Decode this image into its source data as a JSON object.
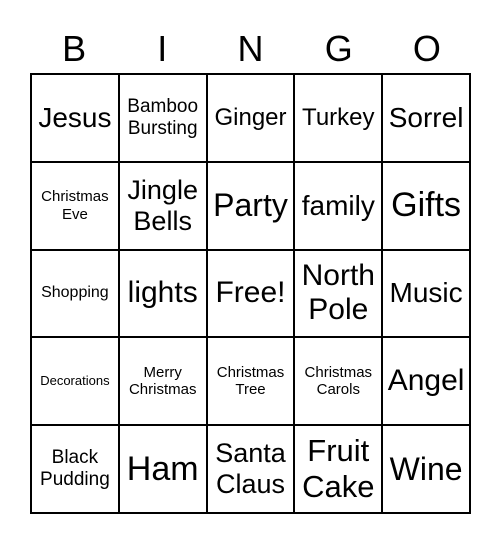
{
  "header": [
    "B",
    "I",
    "N",
    "G",
    "O"
  ],
  "cells": [
    {
      "text": "Jesus",
      "size": 28
    },
    {
      "text": "Bamboo Bursting",
      "size": 19
    },
    {
      "text": "Ginger",
      "size": 24
    },
    {
      "text": "Turkey",
      "size": 24
    },
    {
      "text": "Sorrel",
      "size": 28
    },
    {
      "text": "Christmas Eve",
      "size": 15
    },
    {
      "text": "Jingle Bells",
      "size": 27
    },
    {
      "text": "Party",
      "size": 32
    },
    {
      "text": "family",
      "size": 28
    },
    {
      "text": "Gifts",
      "size": 34
    },
    {
      "text": "Shopping",
      "size": 16
    },
    {
      "text": "lights",
      "size": 30
    },
    {
      "text": "Free!",
      "size": 30
    },
    {
      "text": "North Pole",
      "size": 30
    },
    {
      "text": "Music",
      "size": 28
    },
    {
      "text": "Decorations",
      "size": 13
    },
    {
      "text": "Merry Christmas",
      "size": 15
    },
    {
      "text": "Christmas Tree",
      "size": 15
    },
    {
      "text": "Christmas Carols",
      "size": 15
    },
    {
      "text": "Angel",
      "size": 30
    },
    {
      "text": "Black Pudding",
      "size": 19
    },
    {
      "text": "Ham",
      "size": 34
    },
    {
      "text": "Santa Claus",
      "size": 27
    },
    {
      "text": "Fruit Cake",
      "size": 31
    },
    {
      "text": "Wine",
      "size": 32
    }
  ]
}
